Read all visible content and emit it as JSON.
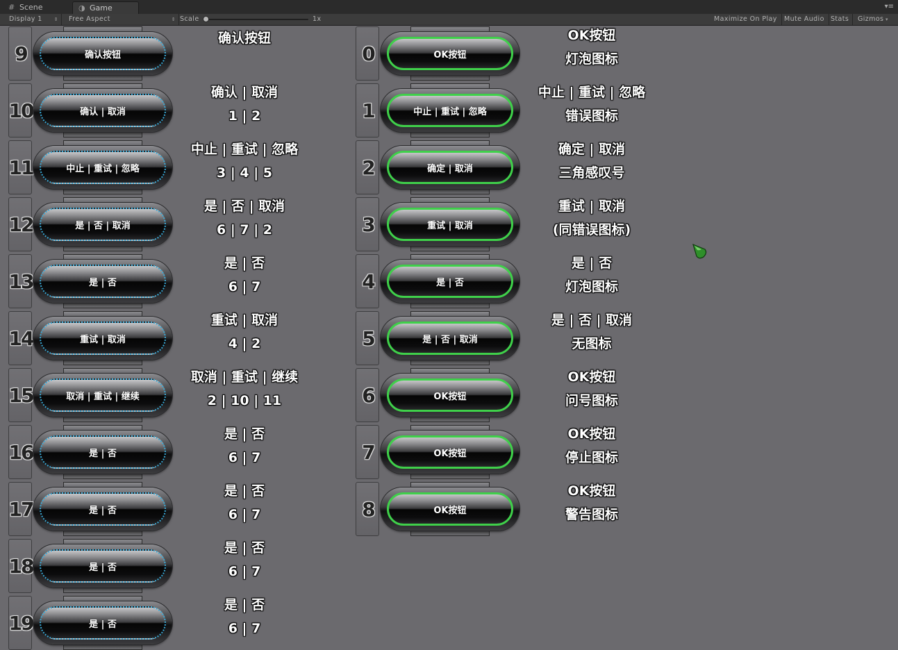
{
  "editor": {
    "tabs": {
      "scene": "Scene",
      "game": "Game"
    },
    "toolbar": {
      "display": "Display 1",
      "aspect": "Free Aspect",
      "scale_label": "Scale",
      "scale_value": "1x",
      "scale_level": 0.0,
      "maximize": "Maximize On Play",
      "mute": "Mute Audio",
      "stats": "Stats",
      "gizmos": "Gizmos"
    },
    "accent_colors": {
      "blue_ring": "#3aa9d6",
      "green_ring": "#3fd04a"
    }
  },
  "left_rows": [
    {
      "num": "9",
      "button": "确认按钮",
      "line1": "确认按钮",
      "line2": ""
    },
    {
      "num": "10",
      "button": "确认 | 取消",
      "line1": "确认 | 取消",
      "line2": "1 | 2"
    },
    {
      "num": "11",
      "button": "中止 | 重试 | 忽略",
      "line1": "中止 | 重试 | 忽略",
      "line2": "3 | 4 | 5"
    },
    {
      "num": "12",
      "button": "是 | 否 | 取消",
      "line1": "是 | 否 | 取消",
      "line2": "6 | 7 | 2"
    },
    {
      "num": "13",
      "button": "是 | 否",
      "line1": "是 | 否",
      "line2": "6 | 7"
    },
    {
      "num": "14",
      "button": "重试 | 取消",
      "line1": "重试 | 取消",
      "line2": "4 | 2"
    },
    {
      "num": "15",
      "button": "取消 | 重试 | 继续",
      "line1": "取消 | 重试 | 继续",
      "line2": "2 | 10 | 11"
    },
    {
      "num": "16",
      "button": "是 | 否",
      "line1": "是 | 否",
      "line2": "6 | 7"
    },
    {
      "num": "17",
      "button": "是 | 否",
      "line1": "是 | 否",
      "line2": "6 | 7"
    },
    {
      "num": "18",
      "button": "是 | 否",
      "line1": "是 | 否",
      "line2": "6 | 7"
    },
    {
      "num": "19",
      "button": "是 | 否",
      "line1": "是 | 否",
      "line2": "6 | 7"
    }
  ],
  "right_rows": [
    {
      "num": "0",
      "button": "OK按钮",
      "line1": "OK按钮",
      "line2": "灯泡图标"
    },
    {
      "num": "1",
      "button": "中止 | 重试 | 忽略",
      "line1": "中止 | 重试 | 忽略",
      "line2": "错误图标"
    },
    {
      "num": "2",
      "button": "确定 | 取消",
      "line1": "确定 | 取消",
      "line2": "三角感叹号"
    },
    {
      "num": "3",
      "button": "重试 | 取消",
      "line1": "重试 | 取消",
      "line2": "(同错误图标)"
    },
    {
      "num": "4",
      "button": "是 | 否",
      "line1": "是 | 否",
      "line2": "灯泡图标"
    },
    {
      "num": "5",
      "button": "是 | 否 | 取消",
      "line1": "是 | 否 | 取消",
      "line2": "无图标"
    },
    {
      "num": "6",
      "button": "OK按钮",
      "line1": "OK按钮",
      "line2": "问号图标"
    },
    {
      "num": "7",
      "button": "OK按钮",
      "line1": "OK按钮",
      "line2": "停止图标"
    },
    {
      "num": "8",
      "button": "OK按钮",
      "line1": "OK按钮",
      "line2": "警告图标"
    }
  ]
}
